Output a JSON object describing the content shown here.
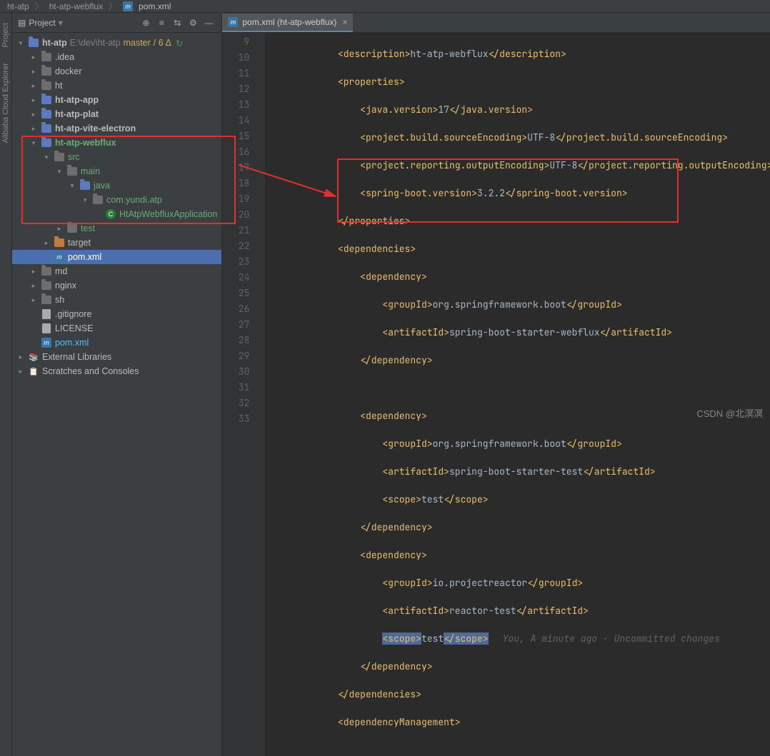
{
  "breadcrumb": {
    "p1": "ht-atp",
    "p2": "ht-atp-webflux",
    "p3": "pom.xml"
  },
  "panel": {
    "title": "Project",
    "icons": {
      "target": "⊕",
      "collapse": "≡",
      "expand": "⇆",
      "gear": "⚙",
      "hide": "—"
    }
  },
  "sidebar": {
    "project": "Project",
    "cloud": "Alibaba Cloud Explorer"
  },
  "tree": {
    "root": "ht-atp",
    "rootPath": "E:\\dev\\ht-atp",
    "branch": "master",
    "delta": "/ 6 Δ",
    "idea": ".idea",
    "docker": "docker",
    "ht": "ht",
    "app": "ht-atp-app",
    "plat": "ht-atp-plat",
    "vite": "ht-atp-vite-electron",
    "webflux": "ht-atp-webflux",
    "src": "src",
    "main": "main",
    "java": "java",
    "pkg": "com.yundi.atp",
    "cls": "HtAtpWebfluxApplication",
    "test": "test",
    "target": "target",
    "pom": "pom.xml",
    "md": "md",
    "nginx": "nginx",
    "sh": "sh",
    "gitignore": ".gitignore",
    "license": "LICENSE",
    "rootpom": "pom.xml",
    "external": "External Libraries",
    "scratches": "Scratches and Consoles"
  },
  "tab": {
    "name": "pom.xml (ht-atp-webflux)"
  },
  "lines": [
    "9",
    "10",
    "11",
    "12",
    "13",
    "14",
    "15",
    "16",
    "17",
    "18",
    "19",
    "20",
    "21",
    "22",
    "23",
    "24",
    "25",
    "26",
    "27",
    "28",
    "29",
    "30",
    "31",
    "32",
    "33"
  ],
  "code": {
    "l9": {
      "ind": "            ",
      "t1": "<description>",
      "tx": "ht-atp-webflux",
      "t2": "</description>"
    },
    "l10": {
      "ind": "            ",
      "t1": "<properties>"
    },
    "l11": {
      "ind": "                ",
      "t1": "<java.version>",
      "tx": "17",
      "t2": "</java.version>"
    },
    "l12": {
      "ind": "                ",
      "t1": "<project.build.sourceEncoding>",
      "tx": "UTF-8",
      "t2": "</project.build.sourceEncoding>"
    },
    "l13": {
      "ind": "                ",
      "t1": "<project.reporting.outputEncoding>",
      "tx": "UTF-8",
      "t2": "</project.reporting.outputEncoding>"
    },
    "l14": {
      "ind": "                ",
      "t1": "<spring-boot.version>",
      "tx": "3.2.2",
      "t2": "</spring-boot.version>"
    },
    "l15": {
      "ind": "            ",
      "t1": "</properties>"
    },
    "l16": {
      "ind": "            ",
      "t1": "<dependencies>"
    },
    "l17": {
      "ind": "                ",
      "t1": "<dependency>"
    },
    "l18": {
      "ind": "                    ",
      "t1": "<groupId>",
      "tx": "org.springframework.boot",
      "t2": "</groupId>"
    },
    "l19": {
      "ind": "                    ",
      "t1": "<artifactId>",
      "tx": "spring-boot-starter-webflux",
      "t2": "</artifactId>"
    },
    "l20": {
      "ind": "                ",
      "t1": "</dependency>"
    },
    "l22": {
      "ind": "                ",
      "t1": "<dependency>"
    },
    "l23": {
      "ind": "                    ",
      "t1": "<groupId>",
      "tx": "org.springframework.boot",
      "t2": "</groupId>"
    },
    "l24": {
      "ind": "                    ",
      "t1": "<artifactId>",
      "tx": "spring-boot-starter-test",
      "t2": "</artifactId>"
    },
    "l25": {
      "ind": "                    ",
      "t1": "<scope>",
      "tx": "test",
      "t2": "</scope>"
    },
    "l26": {
      "ind": "                ",
      "t1": "</dependency>"
    },
    "l27": {
      "ind": "                ",
      "t1": "<dependency>"
    },
    "l28": {
      "ind": "                    ",
      "t1": "<groupId>",
      "tx": "io.projectreactor",
      "t2": "</groupId>"
    },
    "l29": {
      "ind": "                    ",
      "t1": "<artifactId>",
      "tx": "reactor-test",
      "t2": "</artifactId>"
    },
    "l30": {
      "ind": "                    ",
      "t1": "<scope>",
      "tx": "test",
      "t2": "</scope>",
      "hint": "You, A minute ago · Uncommitted changes"
    },
    "l31": {
      "ind": "                ",
      "t1": "</dependency>"
    },
    "l32": {
      "ind": "            ",
      "t1": "</dependencies>"
    },
    "l33": {
      "ind": "            ",
      "t1": "<dependencyManagement>"
    }
  },
  "watermark": "CSDN @北溟溟"
}
